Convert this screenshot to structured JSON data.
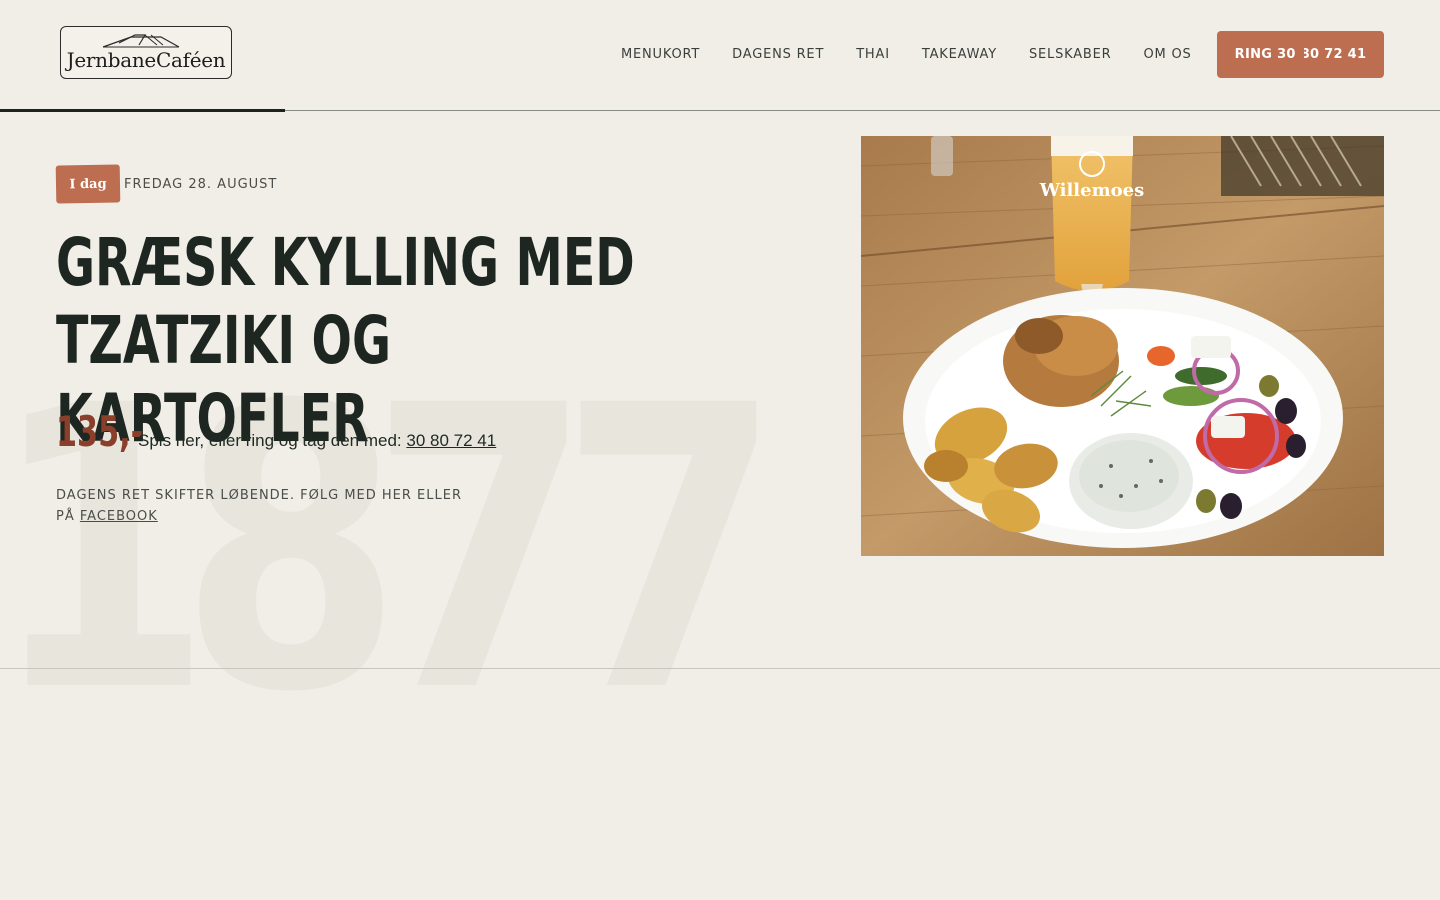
{
  "brand": {
    "name": "JernbaneCaféen"
  },
  "nav": {
    "items": [
      {
        "label": "MENUKORT"
      },
      {
        "label": "DAGENS RET"
      },
      {
        "label": "THAI"
      },
      {
        "label": "TAKEAWAY"
      },
      {
        "label": "SELSKABER"
      },
      {
        "label": "OM OS"
      }
    ],
    "cta_label": "RING 30 80 72 41"
  },
  "hero": {
    "badge": "I dag",
    "date": "FREDAG 28. AUGUST",
    "title_line1": "GRÆSK KYLLING MED",
    "title_line2": "TZATZIKI OG KARTOFLER",
    "price": "135,-",
    "price_text": "Spis her, eller ring og tag den med:",
    "phone_link": "30 80 72 41",
    "note_text_line1": "DAGENS RET SKIFTER LØBENDE. FØLG MED HER ELLER",
    "note_text_line2": "PÅ",
    "facebook_link": "FACEBOOK",
    "background_year": "1877"
  },
  "photo": {
    "glass_text": "Willemoes"
  },
  "colors": {
    "background": "#f1eee7",
    "accent": "#bd6e50",
    "price": "#8a3f2a",
    "text": "#1d2620"
  }
}
